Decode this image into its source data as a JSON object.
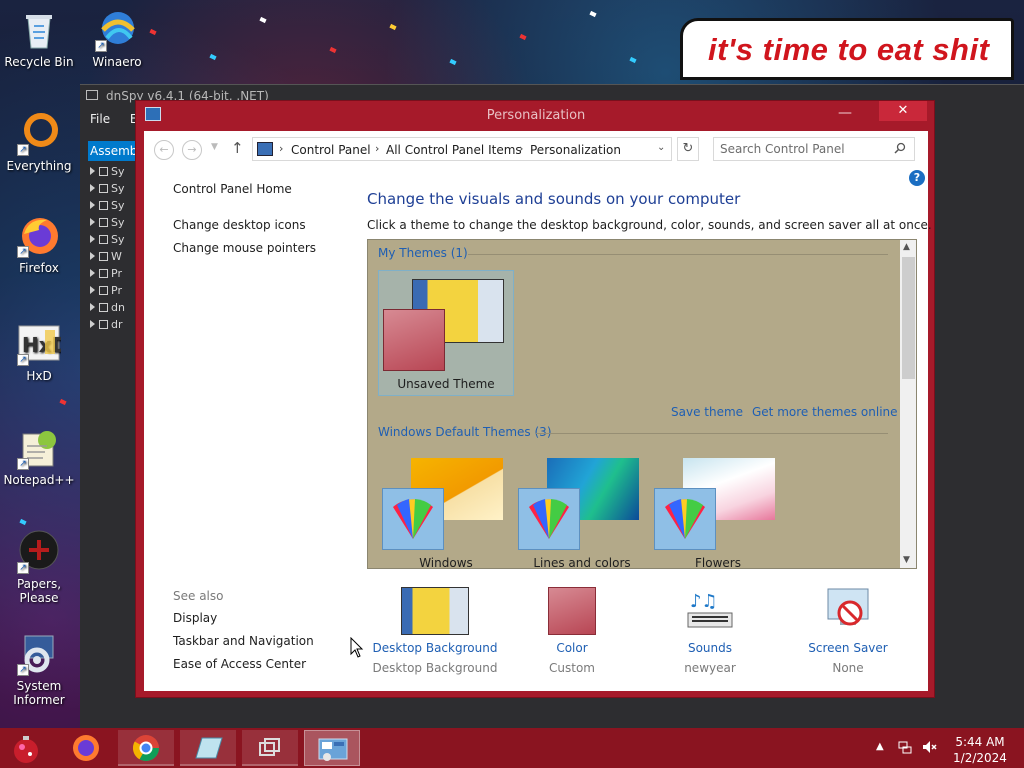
{
  "desktop": {
    "icons": [
      {
        "label": "Recycle Bin",
        "icon": "recycle-bin-icon"
      },
      {
        "label": "Winaero",
        "icon": "winaero-icon"
      },
      {
        "label": "Everything",
        "icon": "everything-icon"
      },
      {
        "label": "Firefox",
        "icon": "firefox-icon"
      },
      {
        "label": "HxD",
        "icon": "hxd-icon"
      },
      {
        "label": "Notepad++",
        "icon": "notepadpp-icon"
      },
      {
        "label": "Papers, Please",
        "icon": "papers-please-icon"
      },
      {
        "label": "System Informer",
        "icon": "system-informer-icon"
      }
    ],
    "banner_text": "it's time to eat shit"
  },
  "dnspy": {
    "title": "dnSpy v6.4.1 (64-bit, .NET)",
    "menu": [
      "File",
      "Ec"
    ],
    "assembly_tab": "Assembl",
    "tree": [
      "Sy",
      "Sy",
      "Sy",
      "Sy",
      "Sy",
      "W",
      "Pr",
      "Pr",
      "dn",
      "dr"
    ]
  },
  "window": {
    "title": "Personalization",
    "accent": "#a61a2a",
    "close_glyph": "✕",
    "min_glyph": "—",
    "max_glyph": "☐",
    "breadcrumbs": [
      "Control Panel",
      "All Control Panel Items",
      "Personalization"
    ],
    "search_placeholder": "Search Control Panel",
    "help_glyph": "?"
  },
  "left_pane": {
    "links": [
      "Control Panel Home",
      "Change desktop icons",
      "Change mouse pointers"
    ],
    "see_also_label": "See also",
    "see_also": [
      "Display",
      "Taskbar and Navigation",
      "Ease of Access Center"
    ]
  },
  "main": {
    "title": "Change the visuals and sounds on your computer",
    "subtitle": "Click a theme to change the desktop background, color, sounds, and screen saver all at once.",
    "my_themes_heading": "My Themes (1)",
    "default_themes_heading": "Windows Default Themes (3)",
    "unsaved_theme_label": "Unsaved Theme",
    "save_theme_link": "Save theme",
    "more_themes_link": "Get more themes online",
    "default_themes": [
      "Windows",
      "Lines and colors",
      "Flowers"
    ]
  },
  "bottom": [
    {
      "label": "Desktop Background",
      "sub": "Desktop Background",
      "icon": "desktop-background-icon"
    },
    {
      "label": "Color",
      "sub": "Custom",
      "icon": "color-icon"
    },
    {
      "label": "Sounds",
      "sub": "newyear",
      "icon": "sounds-icon"
    },
    {
      "label": "Screen Saver",
      "sub": "None",
      "icon": "screen-saver-icon"
    }
  ],
  "taskbar": {
    "time": "5:44 AM",
    "date": "1/2/2024",
    "buttons": [
      "start-button",
      "firefox",
      "chrome",
      "notepad",
      "dnspy",
      "personalization"
    ]
  }
}
